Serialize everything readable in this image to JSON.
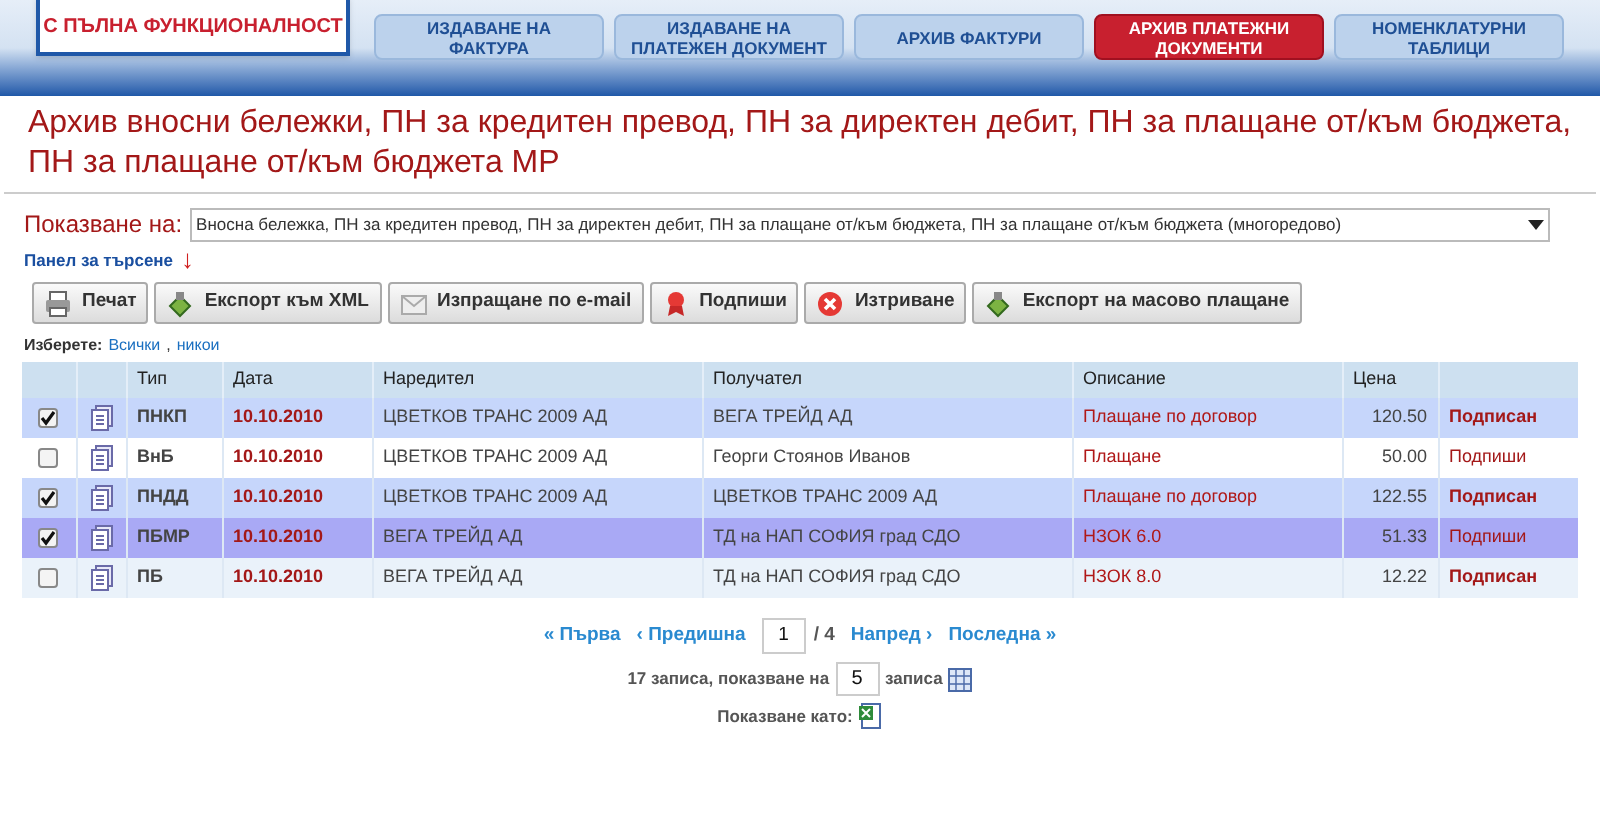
{
  "logo": {
    "subtitle": "С ПЪЛНА ФУНКЦИОНАЛНОСТ"
  },
  "nav": [
    {
      "label": "ИЗДАВАНЕ НА ФАКТУРА",
      "selected": false
    },
    {
      "label": "ИЗДАВАНЕ НА ПЛАТЕЖЕН ДОКУМЕНТ",
      "selected": false
    },
    {
      "label": "АРХИВ ФАКТУРИ",
      "selected": false
    },
    {
      "label": "АРХИВ ПЛАТЕЖНИ ДОКУМЕНТИ",
      "selected": true
    },
    {
      "label": "НОМЕНКЛАТУРНИ ТАБЛИЦИ",
      "selected": false
    }
  ],
  "title": "Архив вносни бележки, ПН за кредитен превод, ПН за директен дебит, ПН за плащане от/към бюджета, ПН за плащане от/към бюджета МР",
  "show": {
    "label": "Показване на:",
    "value": "Вносна бележка, ПН за кредитен превод, ПН за директен дебит, ПН за плащане от/към бюджета, ПН за плащане от/към бюджета (многоредово)"
  },
  "search_panel": {
    "label": "Панел за търсене",
    "arrow": "↓"
  },
  "toolbar": [
    {
      "label": "Печат",
      "kind": "print"
    },
    {
      "label": "Експорт към XML",
      "kind": "export"
    },
    {
      "label": "Изпращане по e-mail",
      "kind": "email"
    },
    {
      "label": "Подпиши",
      "kind": "sign"
    },
    {
      "label": "Изтриване",
      "kind": "delete"
    },
    {
      "label": "Експорт на масово плащане",
      "kind": "export"
    }
  ],
  "select": {
    "label": "Изберете:",
    "all": "Всички",
    "separator": ",",
    "none": "никои"
  },
  "table": {
    "columns": [
      "Тип",
      "Дата",
      "Наредител",
      "Получател",
      "Описание",
      "Цена"
    ],
    "rows": [
      {
        "checked": true,
        "highlighted": false,
        "type": "ПНКП",
        "date": "10.10.2010",
        "payer": "ЦВЕТКОВ ТРАНС 2009 АД",
        "payee": "ВЕГА ТРЕЙД АД",
        "description": "Плащане по договор",
        "price": "120.50",
        "status": "Подписан",
        "signed": true
      },
      {
        "checked": false,
        "highlighted": false,
        "type": "ВнБ",
        "date": "10.10.2010",
        "payer": "ЦВЕТКОВ ТРАНС 2009 АД",
        "payee": "Георги Стоянов Иванов",
        "description": "Плащане",
        "price": "50.00",
        "status": "Подпиши",
        "signed": false
      },
      {
        "checked": true,
        "highlighted": false,
        "type": "ПНДД",
        "date": "10.10.2010",
        "payer": "ЦВЕТКОВ ТРАНС 2009 АД",
        "payee": "ЦВЕТКОВ ТРАНС 2009 АД",
        "description": "Плащане по договор",
        "price": "122.55",
        "status": "Подписан",
        "signed": true
      },
      {
        "checked": true,
        "highlighted": true,
        "type": "ПБМР",
        "date": "10.10.2010",
        "payer": "ВЕГА ТРЕЙД АД",
        "payee": "ТД на НАП СОФИЯ град СДО",
        "description": "НЗОК 6.0",
        "price": "51.33",
        "status": "Подпиши",
        "signed": false
      },
      {
        "checked": false,
        "highlighted": false,
        "type": "ПБ",
        "date": "10.10.2010",
        "payer": "ВЕГА ТРЕЙД АД",
        "payee": "ТД на НАП СОФИЯ град СДО",
        "description": "НЗОК 8.0",
        "price": "12.22",
        "status": "Подписан",
        "signed": true
      }
    ]
  },
  "pagination": {
    "first": "« Първа",
    "prev": "‹ Предишна",
    "page": "1",
    "total": "/ 4",
    "next": "Напред ›",
    "last": "Последна »"
  },
  "records": {
    "before": "17 записа, показване на",
    "count": "5",
    "after": "записа"
  },
  "show_as": {
    "label": "Показване като:"
  }
}
